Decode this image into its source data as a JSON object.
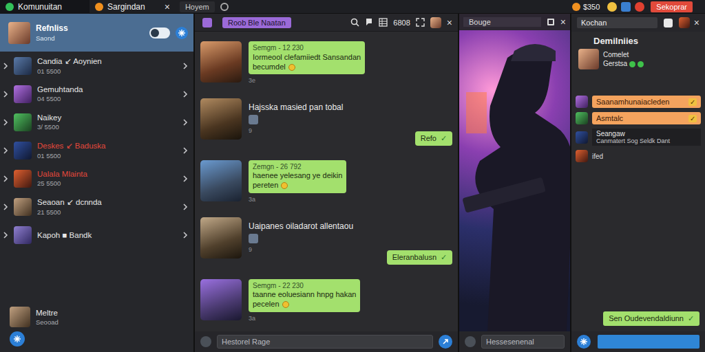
{
  "topbar": {
    "tabs": [
      {
        "label": "Komunuitan",
        "selected": true
      },
      {
        "label": "Sargindan",
        "selected": false
      }
    ],
    "close": "×",
    "menu": "Hoyem",
    "balance": "$350",
    "action": "Sekoprar"
  },
  "sidebar": {
    "toggle_on": true,
    "items": [
      {
        "name": "Refnliss",
        "sub": "Saond",
        "selected": true,
        "color": "#ffffff"
      },
      {
        "name": "Candia ↙ Aoynien",
        "sub": "01 5500",
        "selected": false,
        "color": "#e8e8e8"
      },
      {
        "name": "Gemuhtanda",
        "sub": "04 5500",
        "selected": false,
        "color": "#e8e8e8"
      },
      {
        "name": "Naikey",
        "sub": "3/ 5500",
        "selected": false,
        "color": "#e8e8e8"
      },
      {
        "name": "Deskes ↙ Baduska",
        "sub": "01 5500",
        "selected": false,
        "color": "#e5473b"
      },
      {
        "name": "Ualala Mlainta",
        "sub": "25 5500",
        "selected": false,
        "color": "#e5473b"
      },
      {
        "name": "Seaoan ↙ dcnnda",
        "sub": "21 5500",
        "selected": false,
        "color": "#e8e8e8"
      },
      {
        "name": "Kapoh ■ Bandk",
        "selected": false,
        "color": "#e8e8e8"
      }
    ],
    "footer": {
      "name": "Meltre",
      "sub": "Seooad"
    }
  },
  "chat": {
    "channel": "Roob Ble Naatan",
    "count": "6808",
    "close": "×",
    "messages": [
      {
        "kind": "bubble",
        "lines": [
          "Semgm - 12 230",
          "Iormeool clefamiiedt Sansandan",
          "becumdel"
        ],
        "time": "3e"
      },
      {
        "kind": "plain",
        "text": "Hajsska masied pan tobal",
        "reply": "Refo",
        "tick": "✓",
        "time": "9"
      },
      {
        "kind": "bubble",
        "lines": [
          "Zemgn - 26 792",
          "haenee yelesang ye deikin",
          "pereten"
        ],
        "time": "3a"
      },
      {
        "kind": "plain",
        "text": "Uaipanes oiladarot allentaou",
        "reply": "Eleranbalusn",
        "tick": "✓",
        "time": "9"
      },
      {
        "kind": "bubble",
        "lines": [
          "Semgm - 22 230",
          "taanne eoluesiann hnpg hakan",
          "pecelen"
        ],
        "time": "3a"
      }
    ],
    "input": {
      "placeholder": "Hestorel Rage"
    }
  },
  "video": {
    "title": "Bouge",
    "close": "×",
    "input": {
      "placeholder": "Hessesenenal"
    }
  },
  "side": {
    "search": "Kochan",
    "close": "×",
    "title": "Demilniies",
    "user": "Comelet",
    "status": "Gerstsa",
    "messages": [
      {
        "kind": "orange",
        "text": "Saanamhunaiacleden",
        "tick": "✓"
      },
      {
        "kind": "orange",
        "text": "Asmtalc",
        "tick": "✓"
      },
      {
        "kind": "dark",
        "lines": [
          "Seangaw",
          "Canmatert Sog Seldk Dant"
        ]
      },
      {
        "kind": "plain",
        "text": "ifed"
      }
    ],
    "reply": {
      "text": "Sen Oudevendaldiunn",
      "tick": "✓"
    }
  }
}
